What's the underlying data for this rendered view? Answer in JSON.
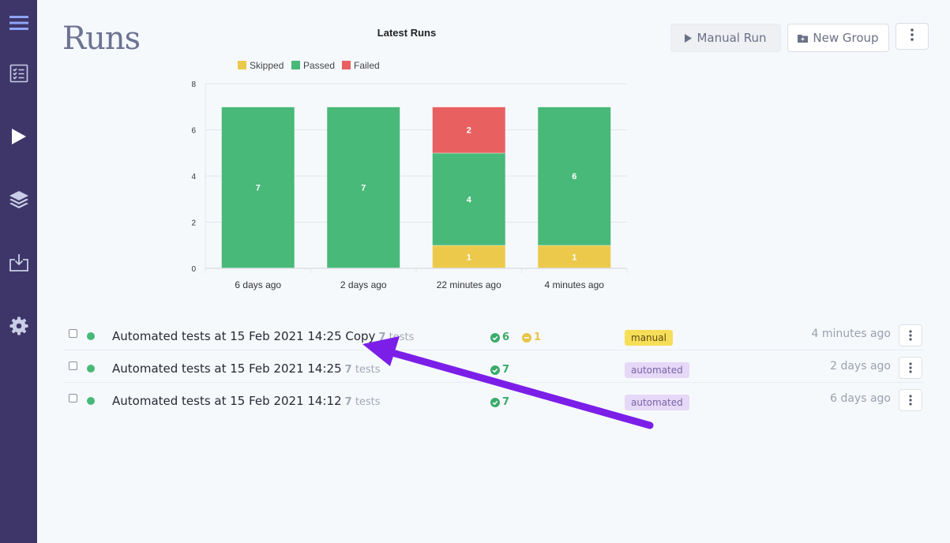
{
  "page": {
    "title": "Runs"
  },
  "sidebar": {
    "items": [
      {
        "icon": "menu-icon"
      },
      {
        "icon": "checklist-icon"
      },
      {
        "icon": "play-icon"
      },
      {
        "icon": "layers-icon"
      },
      {
        "icon": "download-icon"
      },
      {
        "icon": "gear-icon"
      }
    ]
  },
  "toolbar": {
    "manual_run_label": "Manual Run",
    "new_group_label": "New Group"
  },
  "colors": {
    "sidebar": "#3e3669",
    "passed": "#48b978",
    "skipped": "#ecc94b",
    "failed": "#e96060",
    "accent": "#7b1fe8"
  },
  "chart_data": {
    "type": "bar",
    "stacked": true,
    "title": "Latest Runs",
    "categories": [
      "6 days ago",
      "2 days ago",
      "22 minutes ago",
      "4 minutes ago"
    ],
    "series": [
      {
        "name": "Skipped",
        "color": "#ecc94b",
        "values": [
          0,
          0,
          1,
          1
        ]
      },
      {
        "name": "Passed",
        "color": "#48b978",
        "values": [
          7,
          7,
          4,
          6
        ]
      },
      {
        "name": "Failed",
        "color": "#e96060",
        "values": [
          0,
          0,
          2,
          0
        ]
      }
    ],
    "yticks": [
      "0",
      "2",
      "4",
      "6",
      "8"
    ],
    "ylim": [
      0,
      8
    ],
    "legend": "top",
    "grid": true
  },
  "runs": [
    {
      "title": "Automated tests at 15 Feb 2021 14:25 Copy",
      "tests_count": "7",
      "tests_label": "tests",
      "passed": "6",
      "skipped": "1",
      "tag": "manual",
      "time": "4 minutes ago"
    },
    {
      "title": "Automated tests at 15 Feb 2021 14:25",
      "tests_count": "7",
      "tests_label": "tests",
      "passed": "7",
      "tag": "automated",
      "time": "2 days ago"
    },
    {
      "title": "Automated tests at 15 Feb 2021 14:12",
      "tests_count": "7",
      "tests_label": "tests",
      "passed": "7",
      "tag": "automated",
      "time": "6 days ago"
    }
  ]
}
